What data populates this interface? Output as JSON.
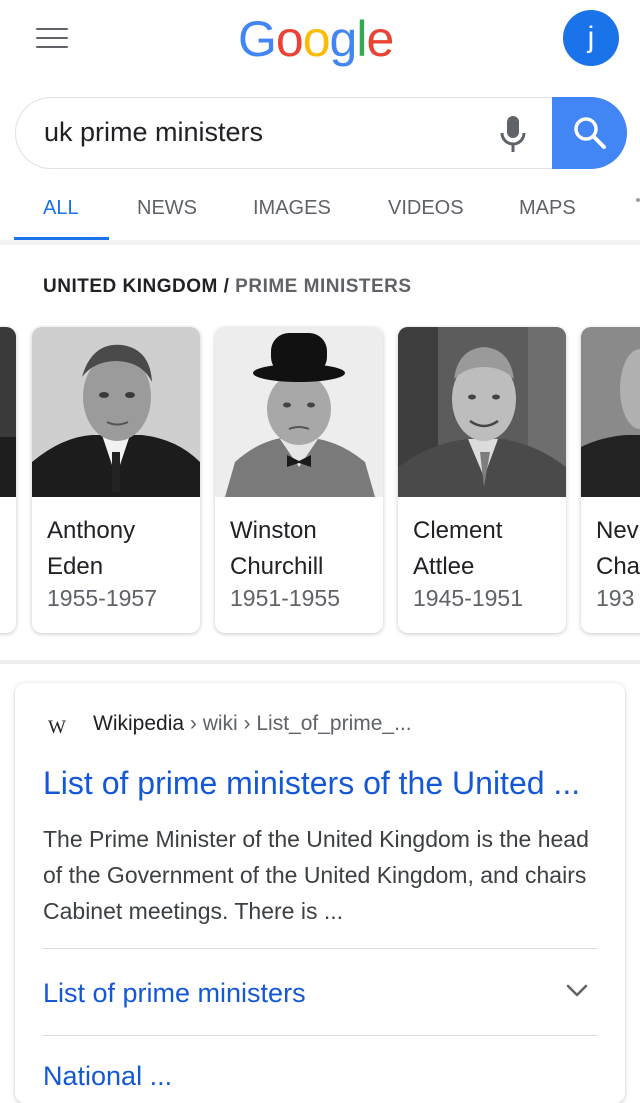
{
  "header": {
    "logo_letters": [
      "G",
      "o",
      "o",
      "g",
      "l",
      "e"
    ],
    "logo_colors": [
      "#4285f4",
      "#ea4335",
      "#fbbc05",
      "#4285f4",
      "#34a853",
      "#ea4335"
    ],
    "avatar_initial": "j"
  },
  "search": {
    "query": "uk prime ministers",
    "icons": [
      "mic-icon",
      "search-icon"
    ]
  },
  "tabs": [
    {
      "label": "ALL",
      "active": true
    },
    {
      "label": "NEWS",
      "active": false
    },
    {
      "label": "IMAGES",
      "active": false
    },
    {
      "label": "VIDEOS",
      "active": false
    },
    {
      "label": "MAPS",
      "active": false
    }
  ],
  "knowledge_panel": {
    "title_main": "UNITED KINGDOM",
    "title_sep": "/",
    "title_sub": "PRIME MINISTERS",
    "cards": [
      {
        "name_line1": "",
        "name_line2": "",
        "years": ""
      },
      {
        "name_line1": "Anthony",
        "name_line2": "Eden",
        "years": "1955-1957"
      },
      {
        "name_line1": "Winston",
        "name_line2": "Churchill",
        "years": "1951-1955"
      },
      {
        "name_line1": "Clement",
        "name_line2": "Attlee",
        "years": "1945-1951"
      },
      {
        "name_line1": "Nev",
        "name_line2": "Cha",
        "years": "193"
      }
    ]
  },
  "result": {
    "source_logo": "W",
    "source_name": "Wikipedia",
    "path": " › wiki › List_of_prime_...",
    "title": "List of prime ministers of the United ...",
    "snippet": "The Prime Minister of the United Kingdom is the head of the Government of the United Kingdom, and chairs Cabinet meetings. There is ...",
    "sublink": "List of prime ministers",
    "next_sublink_partial": "National ..."
  }
}
